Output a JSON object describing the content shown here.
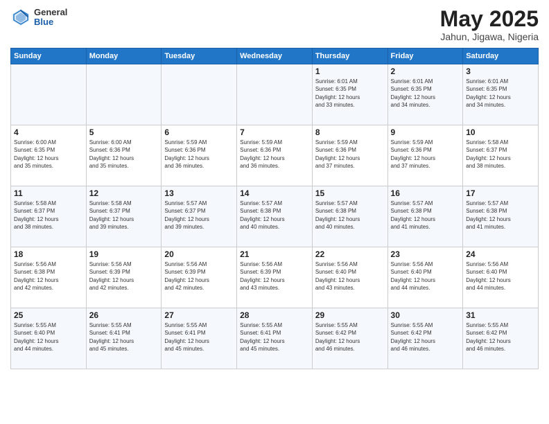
{
  "header": {
    "logo_general": "General",
    "logo_blue": "Blue",
    "month": "May 2025",
    "location": "Jahun, Jigawa, Nigeria"
  },
  "weekdays": [
    "Sunday",
    "Monday",
    "Tuesday",
    "Wednesday",
    "Thursday",
    "Friday",
    "Saturday"
  ],
  "weeks": [
    [
      {
        "day": "",
        "info": ""
      },
      {
        "day": "",
        "info": ""
      },
      {
        "day": "",
        "info": ""
      },
      {
        "day": "",
        "info": ""
      },
      {
        "day": "1",
        "info": "Sunrise: 6:01 AM\nSunset: 6:35 PM\nDaylight: 12 hours\nand 33 minutes."
      },
      {
        "day": "2",
        "info": "Sunrise: 6:01 AM\nSunset: 6:35 PM\nDaylight: 12 hours\nand 34 minutes."
      },
      {
        "day": "3",
        "info": "Sunrise: 6:01 AM\nSunset: 6:35 PM\nDaylight: 12 hours\nand 34 minutes."
      }
    ],
    [
      {
        "day": "4",
        "info": "Sunrise: 6:00 AM\nSunset: 6:35 PM\nDaylight: 12 hours\nand 35 minutes."
      },
      {
        "day": "5",
        "info": "Sunrise: 6:00 AM\nSunset: 6:36 PM\nDaylight: 12 hours\nand 35 minutes."
      },
      {
        "day": "6",
        "info": "Sunrise: 5:59 AM\nSunset: 6:36 PM\nDaylight: 12 hours\nand 36 minutes."
      },
      {
        "day": "7",
        "info": "Sunrise: 5:59 AM\nSunset: 6:36 PM\nDaylight: 12 hours\nand 36 minutes."
      },
      {
        "day": "8",
        "info": "Sunrise: 5:59 AM\nSunset: 6:36 PM\nDaylight: 12 hours\nand 37 minutes."
      },
      {
        "day": "9",
        "info": "Sunrise: 5:59 AM\nSunset: 6:36 PM\nDaylight: 12 hours\nand 37 minutes."
      },
      {
        "day": "10",
        "info": "Sunrise: 5:58 AM\nSunset: 6:37 PM\nDaylight: 12 hours\nand 38 minutes."
      }
    ],
    [
      {
        "day": "11",
        "info": "Sunrise: 5:58 AM\nSunset: 6:37 PM\nDaylight: 12 hours\nand 38 minutes."
      },
      {
        "day": "12",
        "info": "Sunrise: 5:58 AM\nSunset: 6:37 PM\nDaylight: 12 hours\nand 39 minutes."
      },
      {
        "day": "13",
        "info": "Sunrise: 5:57 AM\nSunset: 6:37 PM\nDaylight: 12 hours\nand 39 minutes."
      },
      {
        "day": "14",
        "info": "Sunrise: 5:57 AM\nSunset: 6:38 PM\nDaylight: 12 hours\nand 40 minutes."
      },
      {
        "day": "15",
        "info": "Sunrise: 5:57 AM\nSunset: 6:38 PM\nDaylight: 12 hours\nand 40 minutes."
      },
      {
        "day": "16",
        "info": "Sunrise: 5:57 AM\nSunset: 6:38 PM\nDaylight: 12 hours\nand 41 minutes."
      },
      {
        "day": "17",
        "info": "Sunrise: 5:57 AM\nSunset: 6:38 PM\nDaylight: 12 hours\nand 41 minutes."
      }
    ],
    [
      {
        "day": "18",
        "info": "Sunrise: 5:56 AM\nSunset: 6:38 PM\nDaylight: 12 hours\nand 42 minutes."
      },
      {
        "day": "19",
        "info": "Sunrise: 5:56 AM\nSunset: 6:39 PM\nDaylight: 12 hours\nand 42 minutes."
      },
      {
        "day": "20",
        "info": "Sunrise: 5:56 AM\nSunset: 6:39 PM\nDaylight: 12 hours\nand 42 minutes."
      },
      {
        "day": "21",
        "info": "Sunrise: 5:56 AM\nSunset: 6:39 PM\nDaylight: 12 hours\nand 43 minutes."
      },
      {
        "day": "22",
        "info": "Sunrise: 5:56 AM\nSunset: 6:40 PM\nDaylight: 12 hours\nand 43 minutes."
      },
      {
        "day": "23",
        "info": "Sunrise: 5:56 AM\nSunset: 6:40 PM\nDaylight: 12 hours\nand 44 minutes."
      },
      {
        "day": "24",
        "info": "Sunrise: 5:56 AM\nSunset: 6:40 PM\nDaylight: 12 hours\nand 44 minutes."
      }
    ],
    [
      {
        "day": "25",
        "info": "Sunrise: 5:55 AM\nSunset: 6:40 PM\nDaylight: 12 hours\nand 44 minutes."
      },
      {
        "day": "26",
        "info": "Sunrise: 5:55 AM\nSunset: 6:41 PM\nDaylight: 12 hours\nand 45 minutes."
      },
      {
        "day": "27",
        "info": "Sunrise: 5:55 AM\nSunset: 6:41 PM\nDaylight: 12 hours\nand 45 minutes."
      },
      {
        "day": "28",
        "info": "Sunrise: 5:55 AM\nSunset: 6:41 PM\nDaylight: 12 hours\nand 45 minutes."
      },
      {
        "day": "29",
        "info": "Sunrise: 5:55 AM\nSunset: 6:42 PM\nDaylight: 12 hours\nand 46 minutes."
      },
      {
        "day": "30",
        "info": "Sunrise: 5:55 AM\nSunset: 6:42 PM\nDaylight: 12 hours\nand 46 minutes."
      },
      {
        "day": "31",
        "info": "Sunrise: 5:55 AM\nSunset: 6:42 PM\nDaylight: 12 hours\nand 46 minutes."
      }
    ]
  ]
}
